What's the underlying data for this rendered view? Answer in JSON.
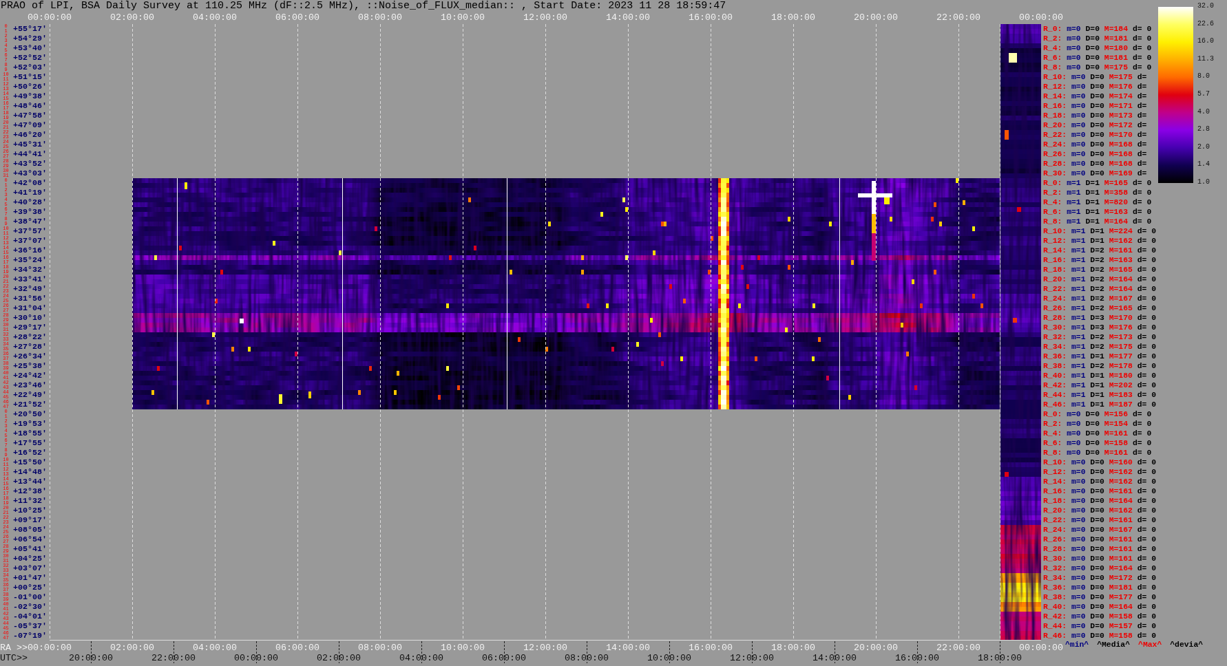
{
  "title": "PRAO of LPI, BSA Daily Survey at 110.25 MHz (dF::2.5 MHz), ::Noise_of_FLUX_median:: , Start Date: 2023 11 28 18:59:47",
  "time_axis": [
    "00:00:00",
    "02:00:00",
    "04:00:00",
    "06:00:00",
    "08:00:00",
    "10:00:00",
    "12:00:00",
    "14:00:00",
    "16:00:00",
    "18:00:00",
    "20:00:00",
    "22:00:00",
    "00:00:00"
  ],
  "rows": [
    {
      "beams": [
        "0",
        "1"
      ],
      "declination": "+55°17'",
      "beam_label": "R_0:",
      "min": "m=0",
      "median": "D=0",
      "max": "M=184",
      "deviation": "d= 0"
    },
    {
      "beams": [
        "2",
        "3"
      ],
      "declination": "+54°29'",
      "beam_label": "R_2:",
      "min": "m=0",
      "median": "D=0",
      "max": "M=181",
      "deviation": "d= 0"
    },
    {
      "beams": [
        "4",
        "5"
      ],
      "declination": "+53°40'",
      "beam_label": "R_4:",
      "min": "m=0",
      "median": "D=0",
      "max": "M=180",
      "deviation": "d= 0"
    },
    {
      "beams": [
        "6",
        "7"
      ],
      "declination": "+52°52'",
      "beam_label": "R_6:",
      "min": "m=0",
      "median": "D=0",
      "max": "M=181",
      "deviation": "d= 0"
    },
    {
      "beams": [
        "8",
        "9"
      ],
      "declination": "+52°03'",
      "beam_label": "R_8:",
      "min": "m=0",
      "median": "D=0",
      "max": "M=175",
      "deviation": "d= 0"
    },
    {
      "beams": [
        "10",
        "11"
      ],
      "declination": "+51°15'",
      "beam_label": "R_10:",
      "min": "m=0",
      "median": "D=0",
      "max": "M=175",
      "deviation": "d="
    },
    {
      "beams": [
        "12",
        "13"
      ],
      "declination": "+50°26'",
      "beam_label": "R_12:",
      "min": "m=0",
      "median": "D=0",
      "max": "M=176",
      "deviation": "d="
    },
    {
      "beams": [
        "14",
        "15"
      ],
      "declination": "+49°38'",
      "beam_label": "R_14:",
      "min": "m=0",
      "median": "D=0",
      "max": "M=174",
      "deviation": "d="
    },
    {
      "beams": [
        "16",
        "17"
      ],
      "declination": "+48°46'",
      "beam_label": "R_16:",
      "min": "m=0",
      "median": "D=0",
      "max": "M=171",
      "deviation": "d="
    },
    {
      "beams": [
        "18",
        "19"
      ],
      "declination": "+47°58'",
      "beam_label": "R_18:",
      "min": "m=0",
      "median": "D=0",
      "max": "M=173",
      "deviation": "d="
    },
    {
      "beams": [
        "20",
        "21"
      ],
      "declination": "+47°09'",
      "beam_label": "R_20:",
      "min": "m=0",
      "median": "D=0",
      "max": "M=172",
      "deviation": "d="
    },
    {
      "beams": [
        "22",
        "23"
      ],
      "declination": "+46°20'",
      "beam_label": "R_22:",
      "min": "m=0",
      "median": "D=0",
      "max": "M=170",
      "deviation": "d="
    },
    {
      "beams": [
        "24",
        "25"
      ],
      "declination": "+45°31'",
      "beam_label": "R_24:",
      "min": "m=0",
      "median": "D=0",
      "max": "M=168",
      "deviation": "d="
    },
    {
      "beams": [
        "26",
        "27"
      ],
      "declination": "+44°41'",
      "beam_label": "R_26:",
      "min": "m=0",
      "median": "D=0",
      "max": "M=168",
      "deviation": "d="
    },
    {
      "beams": [
        "28",
        "29"
      ],
      "declination": "+43°52'",
      "beam_label": "R_28:",
      "min": "m=0",
      "median": "D=0",
      "max": "M=168",
      "deviation": "d="
    },
    {
      "beams": [
        "30",
        "31"
      ],
      "declination": "+43°03'",
      "beam_label": "R_30:",
      "min": "m=0",
      "median": "D=0",
      "max": "M=169",
      "deviation": "d="
    },
    {
      "beams": [
        "0",
        "1"
      ],
      "declination": "+42°08'",
      "beam_label": "R_0:",
      "min": "m=1",
      "median": "D=1",
      "max": "M=165",
      "deviation": "d= 0"
    },
    {
      "beams": [
        "2",
        "3"
      ],
      "declination": "+41°19'",
      "beam_label": "R_2:",
      "min": "m=1",
      "median": "D=1",
      "max": "M=358",
      "deviation": "d= 0"
    },
    {
      "beams": [
        "4",
        "5"
      ],
      "declination": "+40°28'",
      "beam_label": "R_4:",
      "min": "m=1",
      "median": "D=1",
      "max": "M=820",
      "deviation": "d= 0"
    },
    {
      "beams": [
        "6",
        "7"
      ],
      "declination": "+39°38'",
      "beam_label": "R_6:",
      "min": "m=1",
      "median": "D=1",
      "max": "M=163",
      "deviation": "d= 0"
    },
    {
      "beams": [
        "8",
        "9"
      ],
      "declination": "+38°47'",
      "beam_label": "R_8:",
      "min": "m=1",
      "median": "D=1",
      "max": "M=164",
      "deviation": "d= 0"
    },
    {
      "beams": [
        "10",
        "11"
      ],
      "declination": "+37°57'",
      "beam_label": "R_10:",
      "min": "m=1",
      "median": "D=1",
      "max": "M=224",
      "deviation": "d= 0"
    },
    {
      "beams": [
        "12",
        "13"
      ],
      "declination": "+37°07'",
      "beam_label": "R_12:",
      "min": "m=1",
      "median": "D=1",
      "max": "M=162",
      "deviation": "d= 0"
    },
    {
      "beams": [
        "14",
        "15"
      ],
      "declination": "+36°16'",
      "beam_label": "R_14:",
      "min": "m=1",
      "median": "D=2",
      "max": "M=161",
      "deviation": "d= 0"
    },
    {
      "beams": [
        "16",
        "17"
      ],
      "declination": "+35°24'",
      "beam_label": "R_16:",
      "min": "m=1",
      "median": "D=2",
      "max": "M=163",
      "deviation": "d= 0"
    },
    {
      "beams": [
        "18",
        "19"
      ],
      "declination": "+34°32'",
      "beam_label": "R_18:",
      "min": "m=1",
      "median": "D=2",
      "max": "M=165",
      "deviation": "d= 0"
    },
    {
      "beams": [
        "20",
        "21"
      ],
      "declination": "+33°41'",
      "beam_label": "R_20:",
      "min": "m=1",
      "median": "D=2",
      "max": "M=164",
      "deviation": "d= 0"
    },
    {
      "beams": [
        "22",
        "23"
      ],
      "declination": "+32°49'",
      "beam_label": "R_22:",
      "min": "m=1",
      "median": "D=2",
      "max": "M=164",
      "deviation": "d= 0"
    },
    {
      "beams": [
        "24",
        "25"
      ],
      "declination": "+31°56'",
      "beam_label": "R_24:",
      "min": "m=1",
      "median": "D=2",
      "max": "M=167",
      "deviation": "d= 0"
    },
    {
      "beams": [
        "26",
        "27"
      ],
      "declination": "+31°04'",
      "beam_label": "R_26:",
      "min": "m=1",
      "median": "D=2",
      "max": "M=165",
      "deviation": "d= 0"
    },
    {
      "beams": [
        "28",
        "29"
      ],
      "declination": "+30°10'",
      "beam_label": "R_28:",
      "min": "m=1",
      "median": "D=3",
      "max": "M=170",
      "deviation": "d= 0"
    },
    {
      "beams": [
        "30",
        "31"
      ],
      "declination": "+29°17'",
      "beam_label": "R_30:",
      "min": "m=1",
      "median": "D=3",
      "max": "M=176",
      "deviation": "d= 0"
    },
    {
      "beams": [
        "32",
        "33"
      ],
      "declination": "+28°22'",
      "beam_label": "R_32:",
      "min": "m=1",
      "median": "D=2",
      "max": "M=173",
      "deviation": "d= 0"
    },
    {
      "beams": [
        "34",
        "35"
      ],
      "declination": "+27°28'",
      "beam_label": "R_34:",
      "min": "m=1",
      "median": "D=2",
      "max": "M=175",
      "deviation": "d= 0"
    },
    {
      "beams": [
        "36",
        "37"
      ],
      "declination": "+26°34'",
      "beam_label": "R_36:",
      "min": "m=1",
      "median": "D=1",
      "max": "M=177",
      "deviation": "d= 0"
    },
    {
      "beams": [
        "38",
        "39"
      ],
      "declination": "+25°38'",
      "beam_label": "R_38:",
      "min": "m=1",
      "median": "D=2",
      "max": "M=178",
      "deviation": "d= 0"
    },
    {
      "beams": [
        "40",
        "41"
      ],
      "declination": "+24°42'",
      "beam_label": "R_40:",
      "min": "m=1",
      "median": "D=1",
      "max": "M=180",
      "deviation": "d= 0"
    },
    {
      "beams": [
        "42",
        "43"
      ],
      "declination": "+23°46'",
      "beam_label": "R_42:",
      "min": "m=1",
      "median": "D=1",
      "max": "M=202",
      "deviation": "d= 0"
    },
    {
      "beams": [
        "44",
        "45"
      ],
      "declination": "+22°49'",
      "beam_label": "R_44:",
      "min": "m=1",
      "median": "D=1",
      "max": "M=183",
      "deviation": "d= 0"
    },
    {
      "beams": [
        "46",
        "47"
      ],
      "declination": "+21°52'",
      "beam_label": "R_46:",
      "min": "m=1",
      "median": "D=1",
      "max": "M=187",
      "deviation": "d= 0"
    },
    {
      "beams": [
        "0",
        "1"
      ],
      "declination": "+20°50'",
      "beam_label": "R_0:",
      "min": "m=0",
      "median": "D=0",
      "max": "M=156",
      "deviation": "d= 0"
    },
    {
      "beams": [
        "2",
        "3"
      ],
      "declination": "+19°53'",
      "beam_label": "R_2:",
      "min": "m=0",
      "median": "D=0",
      "max": "M=154",
      "deviation": "d= 0"
    },
    {
      "beams": [
        "4",
        "5"
      ],
      "declination": "+18°55'",
      "beam_label": "R_4:",
      "min": "m=0",
      "median": "D=0",
      "max": "M=161",
      "deviation": "d= 0"
    },
    {
      "beams": [
        "6",
        "7"
      ],
      "declination": "+17°55'",
      "beam_label": "R_6:",
      "min": "m=0",
      "median": "D=0",
      "max": "M=158",
      "deviation": "d= 0"
    },
    {
      "beams": [
        "8",
        "9"
      ],
      "declination": "+16°52'",
      "beam_label": "R_8:",
      "min": "m=0",
      "median": "D=0",
      "max": "M=161",
      "deviation": "d= 0"
    },
    {
      "beams": [
        "10",
        "11"
      ],
      "declination": "+15°50'",
      "beam_label": "R_10:",
      "min": "m=0",
      "median": "D=0",
      "max": "M=160",
      "deviation": "d= 0"
    },
    {
      "beams": [
        "12",
        "13"
      ],
      "declination": "+14°48'",
      "beam_label": "R_12:",
      "min": "m=0",
      "median": "D=0",
      "max": "M=162",
      "deviation": "d= 0"
    },
    {
      "beams": [
        "14",
        "15"
      ],
      "declination": "+13°44'",
      "beam_label": "R_14:",
      "min": "m=0",
      "median": "D=0",
      "max": "M=162",
      "deviation": "d= 0"
    },
    {
      "beams": [
        "16",
        "17"
      ],
      "declination": "+12°38'",
      "beam_label": "R_16:",
      "min": "m=0",
      "median": "D=0",
      "max": "M=161",
      "deviation": "d= 0"
    },
    {
      "beams": [
        "18",
        "19"
      ],
      "declination": "+11°32'",
      "beam_label": "R_18:",
      "min": "m=0",
      "median": "D=0",
      "max": "M=164",
      "deviation": "d= 0"
    },
    {
      "beams": [
        "20",
        "21"
      ],
      "declination": "+10°25'",
      "beam_label": "R_20:",
      "min": "m=0",
      "median": "D=0",
      "max": "M=162",
      "deviation": "d= 0"
    },
    {
      "beams": [
        "22",
        "23"
      ],
      "declination": "+09°17'",
      "beam_label": "R_22:",
      "min": "m=0",
      "median": "D=0",
      "max": "M=161",
      "deviation": "d= 0"
    },
    {
      "beams": [
        "24",
        "25"
      ],
      "declination": "+08°05'",
      "beam_label": "R_24:",
      "min": "m=0",
      "median": "D=0",
      "max": "M=167",
      "deviation": "d= 0"
    },
    {
      "beams": [
        "26",
        "27"
      ],
      "declination": "+06°54'",
      "beam_label": "R_26:",
      "min": "m=0",
      "median": "D=0",
      "max": "M=161",
      "deviation": "d= 0"
    },
    {
      "beams": [
        "28",
        "29"
      ],
      "declination": "+05°41'",
      "beam_label": "R_28:",
      "min": "m=0",
      "median": "D=0",
      "max": "M=161",
      "deviation": "d= 0"
    },
    {
      "beams": [
        "30",
        "31"
      ],
      "declination": "+04°25'",
      "beam_label": "R_30:",
      "min": "m=0",
      "median": "D=0",
      "max": "M=161",
      "deviation": "d= 0"
    },
    {
      "beams": [
        "32",
        "33"
      ],
      "declination": "+03°07'",
      "beam_label": "R_32:",
      "min": "m=0",
      "median": "D=0",
      "max": "M=164",
      "deviation": "d= 0"
    },
    {
      "beams": [
        "34",
        "35"
      ],
      "declination": "+01°47'",
      "beam_label": "R_34:",
      "min": "m=0",
      "median": "D=0",
      "max": "M=172",
      "deviation": "d= 0"
    },
    {
      "beams": [
        "36",
        "37"
      ],
      "declination": "+00°25'",
      "beam_label": "R_36:",
      "min": "m=0",
      "median": "D=0",
      "max": "M=181",
      "deviation": "d= 0"
    },
    {
      "beams": [
        "38",
        "39"
      ],
      "declination": "-01°00'",
      "beam_label": "R_38:",
      "min": "m=0",
      "median": "D=0",
      "max": "M=177",
      "deviation": "d= 0"
    },
    {
      "beams": [
        "40",
        "41"
      ],
      "declination": "-02°30'",
      "beam_label": "R_40:",
      "min": "m=0",
      "median": "D=0",
      "max": "M=164",
      "deviation": "d= 0"
    },
    {
      "beams": [
        "42",
        "43"
      ],
      "declination": "-04°01'",
      "beam_label": "R_42:",
      "min": "m=0",
      "median": "D=0",
      "max": "M=158",
      "deviation": "d= 0"
    },
    {
      "beams": [
        "44",
        "45"
      ],
      "declination": "-05°37'",
      "beam_label": "R_44:",
      "min": "m=0",
      "median": "D=0",
      "max": "M=157",
      "deviation": "d= 0"
    },
    {
      "beams": [
        "46",
        "47"
      ],
      "declination": "-07°19'",
      "beam_label": "R_46:",
      "min": "m=0",
      "median": "D=0",
      "max": "M=158",
      "deviation": "d= 0"
    }
  ],
  "stats_legend": {
    "min": "^min^",
    "median": "^Media^",
    "max": "^Max^",
    "deviation": "^devia^"
  },
  "colorbar_ticks": [
    "32.0",
    "22.6",
    "16.0",
    "11.3",
    "8.0",
    "5.7",
    "4.0",
    "2.8",
    "2.0",
    "1.4",
    "1.0"
  ],
  "ra_axis": {
    "prefix": "RA >>",
    "labels": [
      "00:00:00",
      "02:00:00",
      "04:00:00",
      "06:00:00",
      "08:00:00",
      "10:00:00",
      "12:00:00",
      "14:00:00",
      "16:00:00",
      "18:00:00",
      "20:00:00",
      "22:00:00",
      "00:00:00"
    ]
  },
  "utc_axis": {
    "prefix": "UTC>>",
    "labels": [
      "20:00:00",
      "22:00:00",
      "00:00:00",
      "02:00:00",
      "04:00:00",
      "06:00:00",
      "08:00:00",
      "10:00:00",
      "12:00:00",
      "14:00:00",
      "16:00:00",
      "18:00:00"
    ]
  }
}
